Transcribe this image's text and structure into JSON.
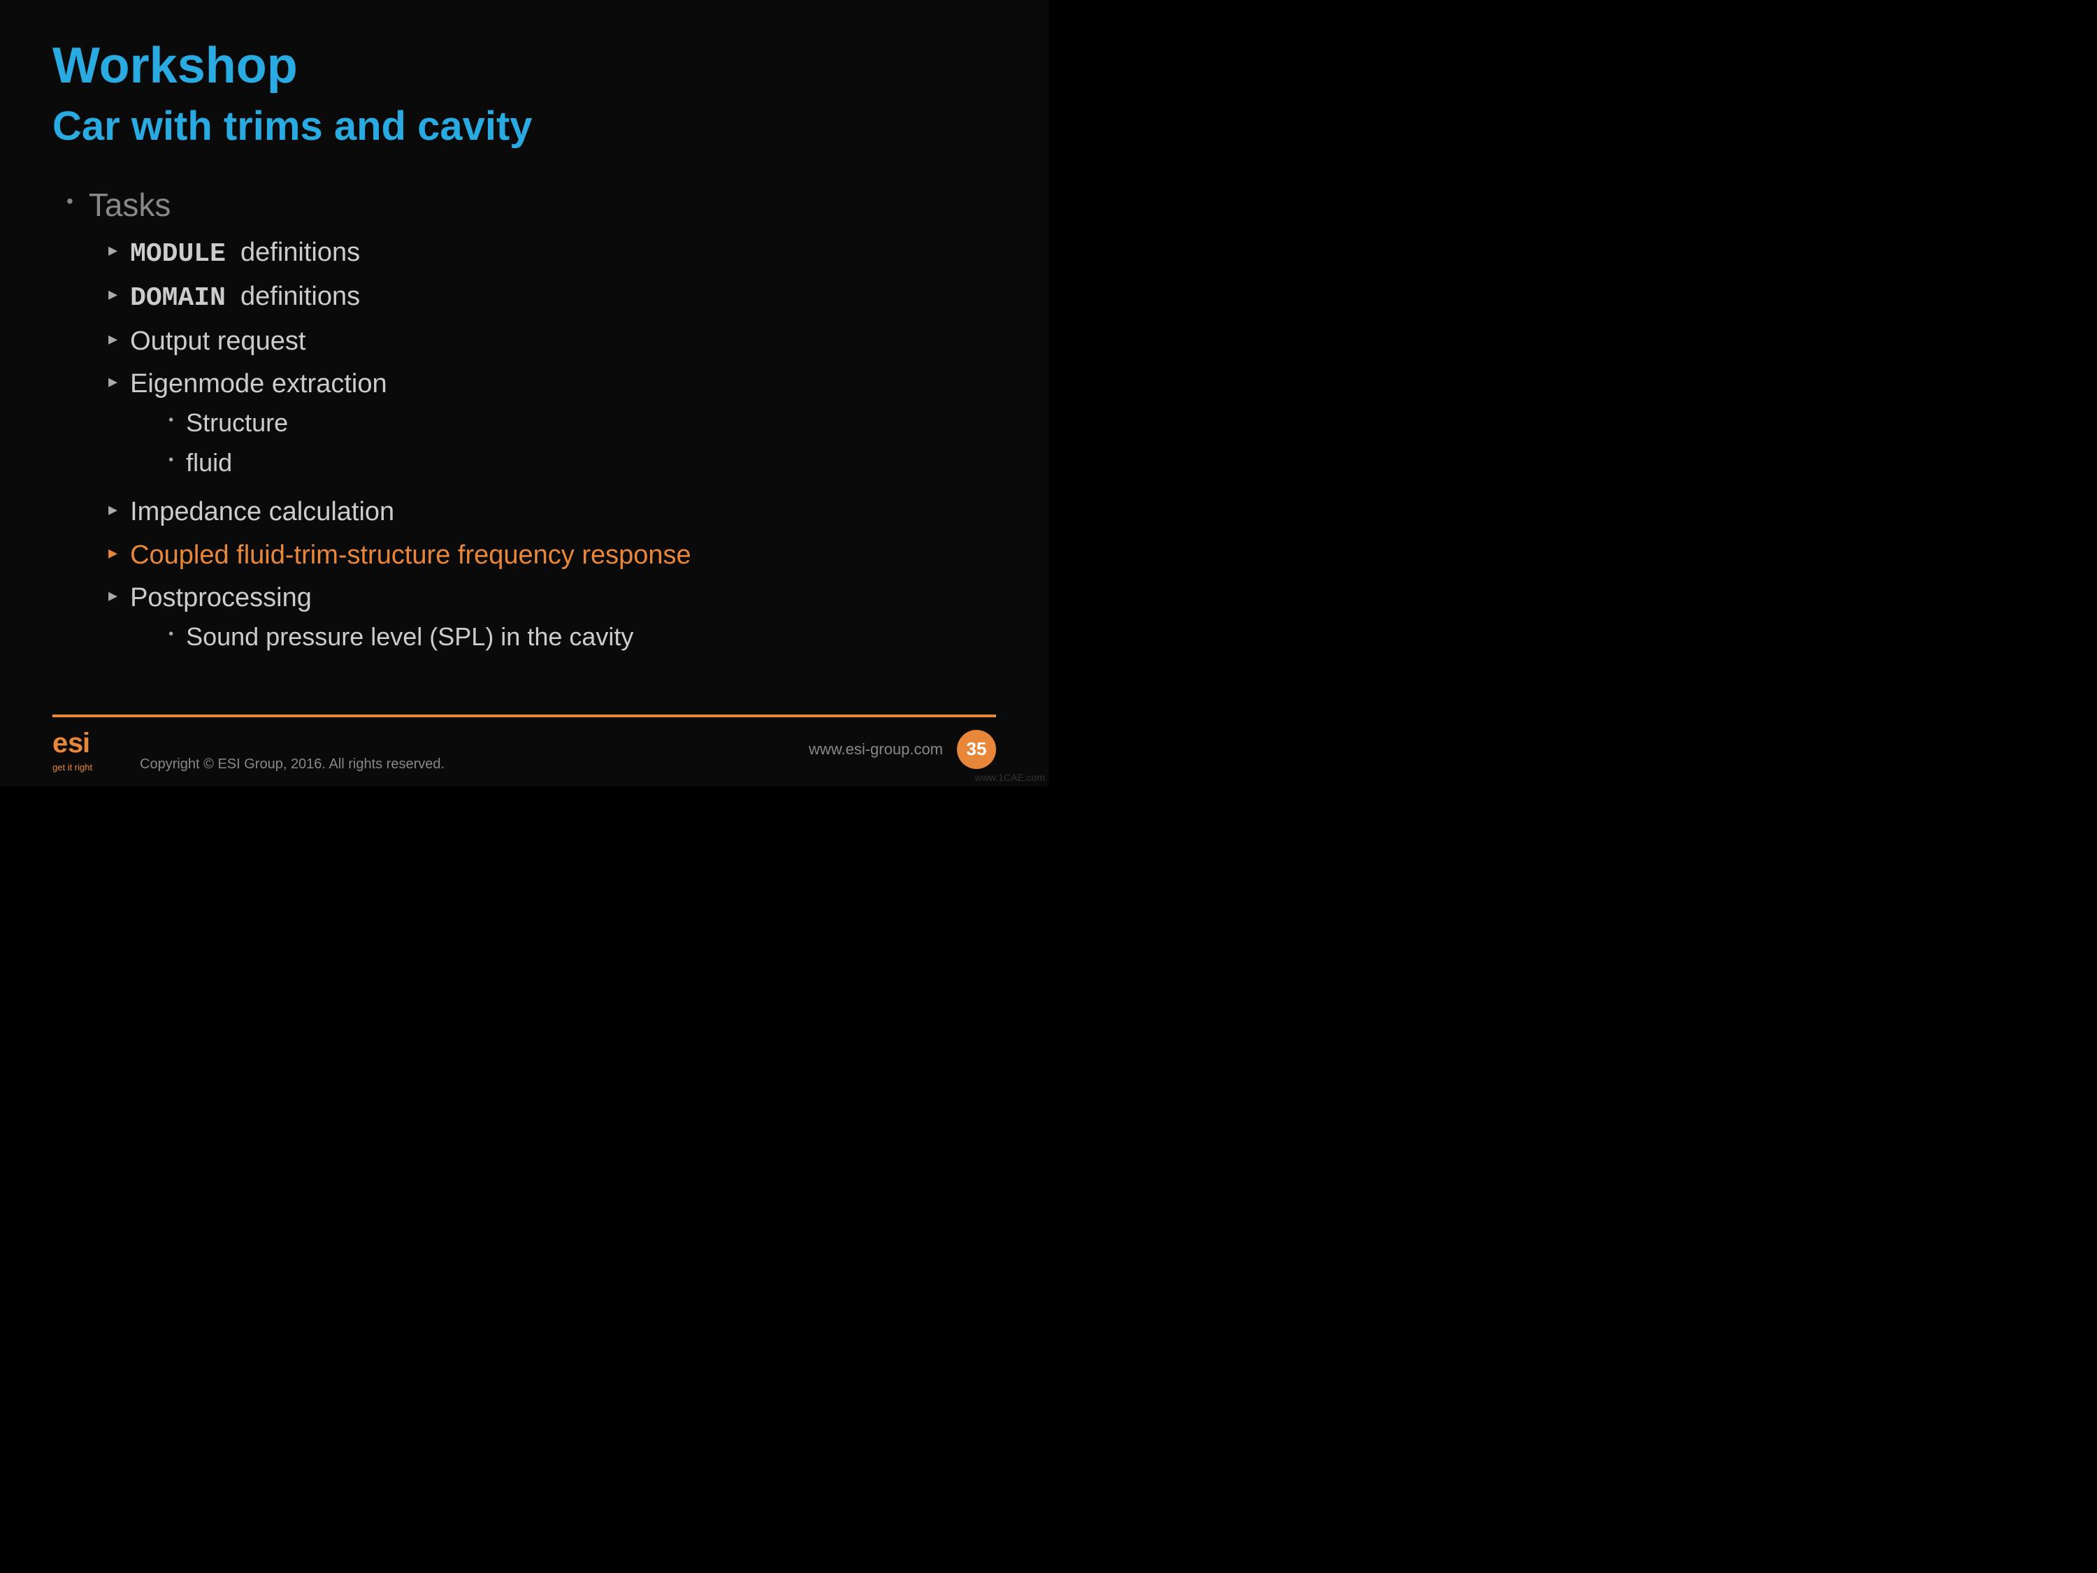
{
  "slide": {
    "title": "Workshop",
    "subtitle": "Car with trims and cavity",
    "tasks_label": "Tasks",
    "items": [
      {
        "keyword": "MODULE",
        "rest": "  definitions",
        "has_keyword": true,
        "highlighted": false
      },
      {
        "keyword": "DOMAIN",
        "rest": "  definitions",
        "has_keyword": true,
        "highlighted": false
      },
      {
        "text": "Output request",
        "has_keyword": false,
        "highlighted": false
      },
      {
        "text": "Eigenmode extraction",
        "has_keyword": false,
        "highlighted": false,
        "children": [
          {
            "text": "Structure"
          },
          {
            "text": "fluid"
          }
        ]
      },
      {
        "text": "Impedance calculation",
        "has_keyword": false,
        "highlighted": false
      },
      {
        "text": "Coupled fluid-trim-structure frequency response",
        "has_keyword": false,
        "highlighted": true
      },
      {
        "text": "Postprocessing",
        "has_keyword": false,
        "highlighted": false,
        "children": [
          {
            "text": "Sound pressure level (SPL) in the cavity"
          }
        ]
      }
    ],
    "footer": {
      "logo_text": "get it right",
      "copyright": "Copyright © ESI Group, 2016. All rights reserved.",
      "url": "www.esi-group.com",
      "page_number": "35",
      "watermark": "www.1CAE.com"
    }
  }
}
